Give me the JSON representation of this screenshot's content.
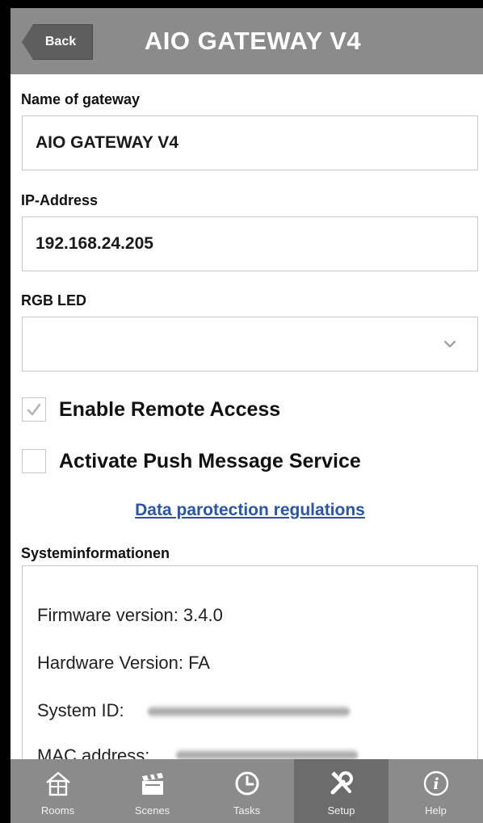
{
  "header": {
    "back_label": "Back",
    "title": "AIO GATEWAY V4"
  },
  "form": {
    "name_label": "Name of gateway",
    "name_value": "AIO GATEWAY V4",
    "ip_label": "IP-Address",
    "ip_value": "192.168.24.205",
    "rgb_label": "RGB LED",
    "rgb_value": ""
  },
  "options": {
    "remote_access_label": "Enable Remote Access",
    "remote_access_checked": true,
    "push_label": "Activate Push Message Service",
    "push_checked": false
  },
  "link_text": "Data parotection regulations",
  "sysinfo": {
    "heading": "Systeminformationen",
    "firmware": "Firmware version: 3.4.0",
    "hardware": "Hardware Version: FA",
    "system_id_label": "System ID:",
    "mac_label": "MAC address:"
  },
  "tabs": [
    {
      "label": "Rooms",
      "icon": "house-icon"
    },
    {
      "label": "Scenes",
      "icon": "clapperboard-icon"
    },
    {
      "label": "Tasks",
      "icon": "clock-icon"
    },
    {
      "label": "Setup",
      "icon": "tools-icon",
      "active": true
    },
    {
      "label": "Help",
      "icon": "info-icon"
    }
  ],
  "colors": {
    "header_bg": "#8b8b8b",
    "back_button_bg": "#5e5e5e",
    "active_tab_bg": "#6c6c6c",
    "link": "#2a55a8"
  }
}
